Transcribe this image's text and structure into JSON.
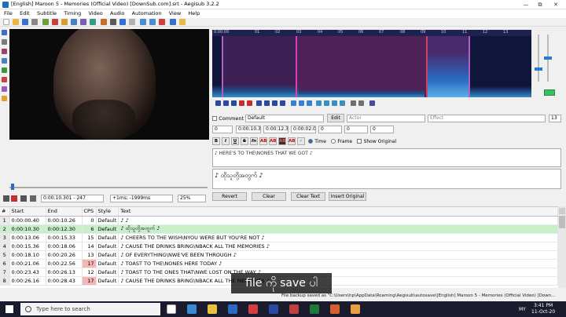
{
  "window": {
    "title": "[English] Maroon 5 - Memories (Official Video) [DownSub.com].srt - Aegisub 3.2.2",
    "minimize": "—",
    "maximize": "⧉",
    "close": "✕"
  },
  "menu": [
    "File",
    "Edit",
    "Subtitle",
    "Timing",
    "Video",
    "Audio",
    "Automation",
    "View",
    "Help"
  ],
  "audio": {
    "ruler_labels": [
      "0:00:00",
      "01",
      "02",
      "03",
      "04",
      "05",
      "06",
      "07",
      "08",
      "09",
      "10",
      "11",
      "12",
      "13"
    ],
    "colors": {
      "background": "#10153a",
      "selection": "#6e3278",
      "line_start": "#e03cb4",
      "line_end": "#d04060"
    }
  },
  "editor": {
    "comment_label": "Comment",
    "style_value": "Default",
    "edit_button": "Edit",
    "actor_placeholder": "Actor",
    "effect_placeholder": "Effect",
    "margin_value": "13",
    "layer": "0",
    "start_time": "0:00:10.30",
    "end_time": "0:00:12.30",
    "duration": "0:00:02.00",
    "margin_l": "0",
    "margin_r": "0",
    "margin_v": "0",
    "fmt_buttons": [
      "B",
      "I",
      "U",
      "S",
      "fn",
      "AB",
      "AB",
      "AB",
      "AB"
    ],
    "time_radio": "Time",
    "frame_radio": "Frame",
    "show_original": "Show Original",
    "original_text": "♪ HERE'S TO THE\\NONES THAT WE GOT ♪",
    "edit_text": "♪ ထိုသူတို့အတွက် ♪",
    "revert": "Revert",
    "clear": "Clear",
    "clear_text": "Clear Text",
    "insert_original": "Insert Original"
  },
  "seek": {
    "current_time": "0:00:10.301 - 247",
    "offset": "+1ms; -1999ms",
    "zoom": "25%"
  },
  "grid": {
    "headers": [
      "#",
      "Start",
      "End",
      "CPS",
      "Style",
      "Text"
    ],
    "rows": [
      {
        "n": "1",
        "start": "0:00:00.40",
        "end": "0:00:10.26",
        "cps": "0",
        "style": "Default",
        "text": "♪ ♪",
        "hi": false,
        "active": false
      },
      {
        "n": "2",
        "start": "0:00:10.30",
        "end": "0:00:12.30",
        "cps": "6",
        "style": "Default",
        "text": "♪ ထိုသူတို့အတွက် ♪",
        "hi": false,
        "active": true
      },
      {
        "n": "3",
        "start": "0:00:13.06",
        "end": "0:00:15.33",
        "cps": "15",
        "style": "Default",
        "text": "♪ CHEERS TO THE WISH\\NYOU WERE BUT YOU'RE NOT ♪",
        "hi": false,
        "active": false
      },
      {
        "n": "4",
        "start": "0:00:15.36",
        "end": "0:00:18.06",
        "cps": "14",
        "style": "Default",
        "text": "♪ CAUSE THE DRINKS BRING\\NBACK ALL THE MEMORIES ♪",
        "hi": false,
        "active": false
      },
      {
        "n": "5",
        "start": "0:00:18.10",
        "end": "0:00:20.26",
        "cps": "13",
        "style": "Default",
        "text": "♪ OF EVERYTHING\\NWE'VE BEEN THROUGH ♪",
        "hi": false,
        "active": false
      },
      {
        "n": "6",
        "start": "0:00:21.06",
        "end": "0:00:22.56",
        "cps": "17",
        "style": "Default",
        "text": "♪ TOAST TO THE\\NONES HERE TODAY ♪",
        "hi": true,
        "active": false
      },
      {
        "n": "7",
        "start": "0:00:23.43",
        "end": "0:00:26.13",
        "cps": "12",
        "style": "Default",
        "text": "♪ TOAST TO THE ONES THAT\\NWE LOST ON THE WAY ♪",
        "hi": false,
        "active": false
      },
      {
        "n": "8",
        "start": "0:00:26.16",
        "end": "0:00:28.43",
        "cps": "17",
        "style": "Default",
        "text": "♪ CAUSE THE DRINKS BRING\\NBACK ALL THE MEMORIES ♪",
        "hi": true,
        "active": false
      }
    ]
  },
  "caption": "file ကို save ပါ",
  "status": "File backup saved as \"C:\\Users\\hp\\AppData\\Roaming\\Aegisub\\autosave\\[English] Maroon 5 - Memories (Official Video) [Down...",
  "taskbar": {
    "search_placeholder": "Type here to search",
    "time": "3:41 PM",
    "date": "11-Oct-20",
    "lang": "MY"
  }
}
